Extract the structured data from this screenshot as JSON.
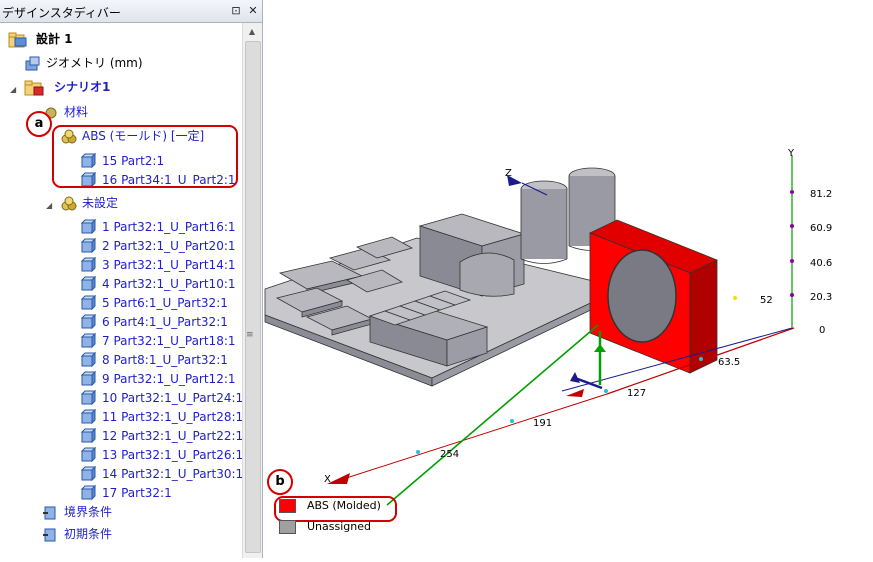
{
  "panel": {
    "title": "デザインスタディバー",
    "pin_label": "⊡",
    "close_label": "✕"
  },
  "tree": {
    "design": "設計 1",
    "geometry": "ジオメトリ (mm)",
    "scenario": "シナリオ1",
    "materials": "材料",
    "abs_group": "ABS (モールド) [一定]",
    "abs_parts": [
      "15 Part2:1",
      "16 Part34:1_U_Part2:1"
    ],
    "unassigned": "未設定",
    "unassigned_parts": [
      "1 Part32:1_U_Part16:1",
      "2 Part32:1_U_Part20:1",
      "3 Part32:1_U_Part14:1",
      "4 Part32:1_U_Part10:1",
      "5 Part6:1_U_Part32:1",
      "6 Part4:1_U_Part32:1",
      "7 Part32:1_U_Part18:1",
      "8 Part8:1_U_Part32:1",
      "9 Part32:1_U_Part12:1",
      "10 Part32:1_U_Part24:1",
      "11 Part32:1_U_Part28:1",
      "12 Part32:1_U_Part22:1",
      "13 Part32:1_U_Part26:1",
      "14 Part32:1_U_Part30:1",
      "17 Part32:1"
    ],
    "boundary": "境界条件",
    "initial": "初期条件"
  },
  "annotations": {
    "a": "a",
    "b": "b"
  },
  "axes": {
    "y_label": "Y",
    "z_label": "Z",
    "x_label": "X",
    "y_ticks": [
      "81.2",
      "60.9",
      "40.6",
      "20.3",
      "0"
    ],
    "x_ticks": [
      "63.5",
      "127",
      "191",
      "254"
    ],
    "z_tick": "52"
  },
  "legend": {
    "items": [
      {
        "label": "ABS (Molded)",
        "color": "#ff0000"
      },
      {
        "label": "Unassigned",
        "color": "#a0a0a0"
      }
    ]
  },
  "colors": {
    "accent_red": "#d40000",
    "tree_link": "#1f1fc8",
    "x_axis": "#c00000",
    "y_axis": "#00a000",
    "z_axis": "#1a1a8c"
  }
}
